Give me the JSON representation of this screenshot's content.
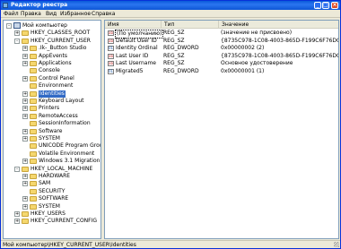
{
  "window": {
    "title": "Редактор реестра"
  },
  "menu": [
    "Файл",
    "Правка",
    "Вид",
    "Избранное",
    "Справка"
  ],
  "tree": [
    {
      "label": "Мой компьютер",
      "level": 0,
      "exp": "-",
      "icon": "computer"
    },
    {
      "label": "HKEY_CLASSES_ROOT",
      "level": 1,
      "exp": "+",
      "icon": "folder"
    },
    {
      "label": "HKEY_CURRENT_USER",
      "level": 1,
      "exp": "-",
      "icon": "folder"
    },
    {
      "label": ".Ik-_Button Studio",
      "level": 2,
      "exp": "+",
      "icon": "folder"
    },
    {
      "label": "AppEvents",
      "level": 2,
      "exp": "+",
      "icon": "folder"
    },
    {
      "label": "Applications",
      "level": 2,
      "exp": "+",
      "icon": "folder"
    },
    {
      "label": "Console",
      "level": 2,
      "exp": "",
      "icon": "folder"
    },
    {
      "label": "Control Panel",
      "level": 2,
      "exp": "+",
      "icon": "folder"
    },
    {
      "label": "Environment",
      "level": 2,
      "exp": "",
      "icon": "folder"
    },
    {
      "label": "Identities",
      "level": 2,
      "exp": "+",
      "icon": "folder",
      "selected": true
    },
    {
      "label": "Keyboard Layout",
      "level": 2,
      "exp": "+",
      "icon": "folder"
    },
    {
      "label": "Printers",
      "level": 2,
      "exp": "+",
      "icon": "folder"
    },
    {
      "label": "RemoteAccess",
      "level": 2,
      "exp": "+",
      "icon": "folder"
    },
    {
      "label": "SessionInformation",
      "level": 2,
      "exp": "",
      "icon": "folder"
    },
    {
      "label": "Software",
      "level": 2,
      "exp": "+",
      "icon": "folder"
    },
    {
      "label": "SYSTEM",
      "level": 2,
      "exp": "+",
      "icon": "folder"
    },
    {
      "label": "UNICODE Program Groups",
      "level": 2,
      "exp": "",
      "icon": "folder"
    },
    {
      "label": "Volatile Environment",
      "level": 2,
      "exp": "",
      "icon": "folder"
    },
    {
      "label": "Windows 3.1 Migration Stat",
      "level": 2,
      "exp": "+",
      "icon": "folder"
    },
    {
      "label": "HKEY_LOCAL_MACHINE",
      "level": 1,
      "exp": "-",
      "icon": "folder"
    },
    {
      "label": "HARDWARE",
      "level": 2,
      "exp": "+",
      "icon": "folder"
    },
    {
      "label": "SAM",
      "level": 2,
      "exp": "+",
      "icon": "folder"
    },
    {
      "label": "SECURITY",
      "level": 2,
      "exp": "",
      "icon": "folder"
    },
    {
      "label": "SOFTWARE",
      "level": 2,
      "exp": "+",
      "icon": "folder"
    },
    {
      "label": "SYSTEM",
      "level": 2,
      "exp": "+",
      "icon": "folder"
    },
    {
      "label": "HKEY_USERS",
      "level": 1,
      "exp": "+",
      "icon": "folder"
    },
    {
      "label": "HKEY_CURRENT_CONFIG",
      "level": 1,
      "exp": "+",
      "icon": "folder"
    }
  ],
  "list": {
    "columns": [
      "Имя",
      "Тип",
      "Значение"
    ],
    "rows": [
      {
        "name": "(По умолчанию)",
        "type": "REG_SZ",
        "value": "(значение не присвоено)",
        "icon": "ab",
        "focused": true
      },
      {
        "name": "Default User ID",
        "type": "REG_SZ",
        "value": "{8735C978-1C08-4003-865D-F199C6F76DC4}",
        "icon": "ab"
      },
      {
        "name": "Identity Ordinal",
        "type": "REG_DWORD",
        "value": "0x00000002 (2)",
        "icon": "bin"
      },
      {
        "name": "Last User ID",
        "type": "REG_SZ",
        "value": "{8735C978-1C08-4003-865D-F199C6F76DC4}",
        "icon": "ab"
      },
      {
        "name": "Last Username",
        "type": "REG_SZ",
        "value": "Основное удостоверение",
        "icon": "ab"
      },
      {
        "name": "Migrated5",
        "type": "REG_DWORD",
        "value": "0x00000001 (1)",
        "icon": "bin"
      }
    ]
  },
  "status": "Мой компьютер\\HKEY_CURRENT_USER\\Identities"
}
